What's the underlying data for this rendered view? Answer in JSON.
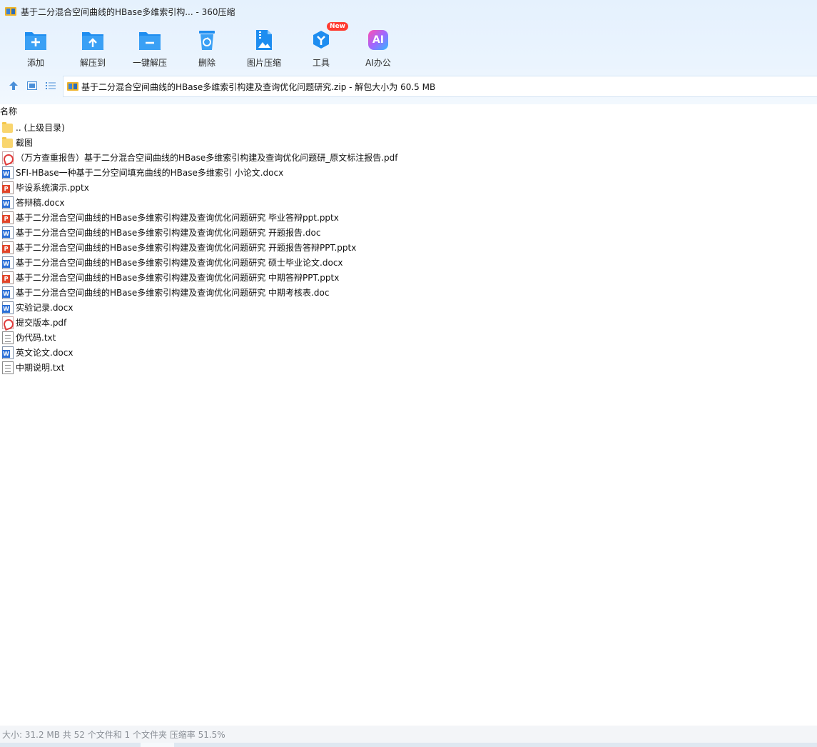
{
  "window": {
    "title": "基于二分混合空间曲线的HBase多维索引构... - 360压缩"
  },
  "toolbar": {
    "buttons": [
      {
        "label": "添加",
        "icon": "add-icon"
      },
      {
        "label": "解压到",
        "icon": "extract-to-icon"
      },
      {
        "label": "一键解压",
        "icon": "one-click-extract-icon"
      },
      {
        "label": "删除",
        "icon": "delete-icon"
      },
      {
        "label": "图片压缩",
        "icon": "image-compress-icon"
      },
      {
        "label": "工具",
        "icon": "tools-icon",
        "badge": "New"
      },
      {
        "label": "AI办公",
        "icon": "ai-office-icon",
        "icon_text": "AI"
      }
    ]
  },
  "address": {
    "path": "基于二分混合空间曲线的HBase多维索引构建及查询优化问题研究.zip - 解包大小为 60.5 MB"
  },
  "list": {
    "column_name": "名称",
    "items": [
      {
        "name": ".. (上级目录)",
        "type": "folder"
      },
      {
        "name": "截图",
        "type": "folder"
      },
      {
        "name": "（万方查重报告）基于二分混合空间曲线的HBase多维索引构建及查询优化问题研_原文标注报告.pdf",
        "type": "pdf"
      },
      {
        "name": "SFI-HBase一种基于二分空间填充曲线的HBase多维索引 小论文.docx",
        "type": "doc"
      },
      {
        "name": "毕设系统演示.pptx",
        "type": "ppt"
      },
      {
        "name": "答辩稿.docx",
        "type": "doc"
      },
      {
        "name": "基于二分混合空间曲线的HBase多维索引构建及查询优化问题研究  毕业答辩ppt.pptx",
        "type": "ppt"
      },
      {
        "name": "基于二分混合空间曲线的HBase多维索引构建及查询优化问题研究  开题报告.doc",
        "type": "doc"
      },
      {
        "name": "基于二分混合空间曲线的HBase多维索引构建及查询优化问题研究  开题报告答辩PPT.pptx",
        "type": "ppt"
      },
      {
        "name": "基于二分混合空间曲线的HBase多维索引构建及查询优化问题研究  硕士毕业论文.docx",
        "type": "doc"
      },
      {
        "name": "基于二分混合空间曲线的HBase多维索引构建及查询优化问题研究  中期答辩PPT.pptx",
        "type": "ppt"
      },
      {
        "name": "基于二分混合空间曲线的HBase多维索引构建及查询优化问题研究  中期考核表.doc",
        "type": "doc"
      },
      {
        "name": "实验记录.docx",
        "type": "doc"
      },
      {
        "name": "提交版本.pdf",
        "type": "pdf"
      },
      {
        "name": "伪代码.txt",
        "type": "txt"
      },
      {
        "name": "英文论文.docx",
        "type": "doc"
      },
      {
        "name": "中期说明.txt",
        "type": "txt"
      }
    ]
  },
  "status": {
    "text": "大小: 31.2 MB 共 52 个文件和 1 个文件夹 压缩率 51.5%"
  },
  "colors": {
    "toolbar_icon_blue": "#1e8df0",
    "new_badge": "#ff3b30",
    "word_blue": "#2b6fd6",
    "ppt_red": "#e1452a",
    "pdf_red": "#e03a3a",
    "folder_yellow": "#f9d56e"
  }
}
